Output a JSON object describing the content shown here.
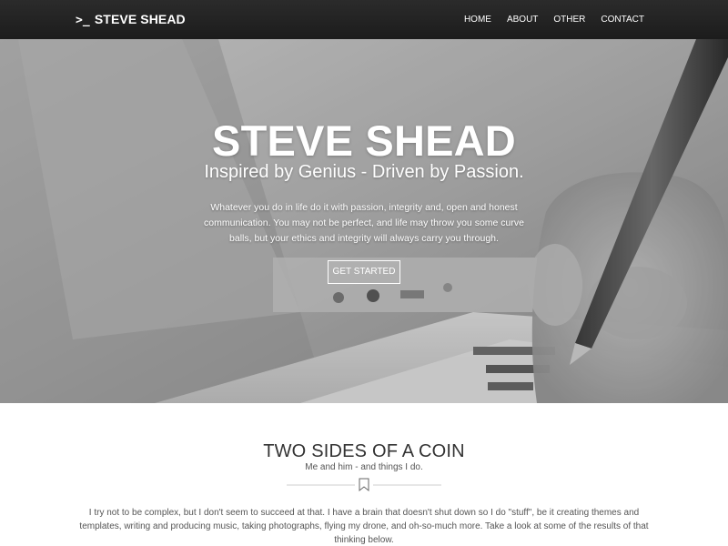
{
  "nav": {
    "brand_prompt": ">_",
    "brand_name": "STEVE SHEAD",
    "links": [
      "HOME",
      "ABOUT",
      "OTHER",
      "CONTACT"
    ]
  },
  "hero": {
    "title": "STEVE SHEAD",
    "subtitle": "Inspired by Genius - Driven by Passion.",
    "text": "Whatever you do in life do it with passion, integrity and, open and honest communication. You may not be perfect, and life may throw you some curve balls, but your ethics and integrity will always carry you through.",
    "button_label": "GET STARTED"
  },
  "section": {
    "title": "TWO SIDES OF A COIN",
    "subtitle": "Me and him - and things I do.",
    "body": "I try not to be complex, but I don't seem to succeed at that. I have a brain that doesn't shut down so I do \"stuff\", be it creating themes and templates, writing and producing music, taking photographs, flying my drone, and oh-so-much more. Take a look at some of the results of that thinking below."
  },
  "colors": {
    "navbar": "#1f1f1f",
    "hero_text": "#ffffff",
    "section_title": "#333333"
  }
}
